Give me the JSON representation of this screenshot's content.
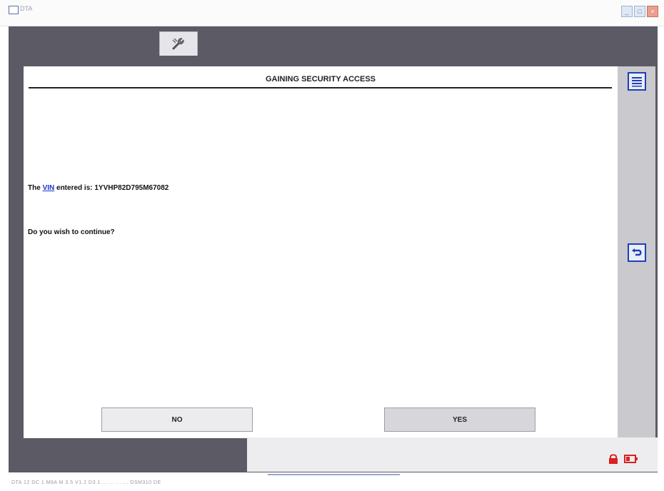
{
  "window": {
    "title": "DTA"
  },
  "toolbar": {
    "active_tab_icon": "wrench-icon"
  },
  "screen": {
    "heading": "GAINING SECURITY ACCESS",
    "vin_prefix": "The",
    "vin_link": "VIN",
    "vin_middle": "entered is:",
    "vin_value": "1YVHP82D795M67082",
    "question": "Do you wish to continue?",
    "no_label": "NO",
    "yes_label": "YES"
  },
  "sidebar": {
    "top_icon": "list-menu-icon",
    "middle_icon": "back-arrow-icon"
  },
  "footer": {
    "icons": [
      "lock-icon",
      "battery-icon"
    ]
  },
  "statusbar": {
    "text": "DTA 12    DC 1        M8A      M 3.5      V1.2    D3.1    ...  ...  ...  ...   DSM310    DE"
  },
  "colors": {
    "frame": "#5b5a65",
    "accent": "#1f3fb8",
    "link": "#1a35c8",
    "lock": "#d92121"
  }
}
